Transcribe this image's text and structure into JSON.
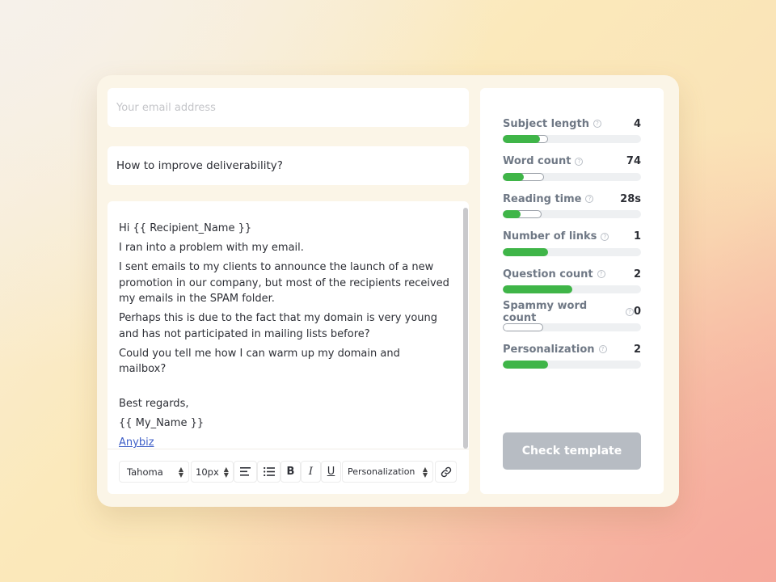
{
  "email": {
    "placeholder": "Your email address",
    "value": ""
  },
  "subject": "How to improve deliverability?",
  "body": {
    "greeting": "Hi {{ Recipient_Name }}",
    "line1": "I ran into a problem with my email.",
    "line2": "I sent emails to my clients to announce the launch of a new promotion in our company, but most of the recipients received my emails in the SPAM folder.",
    "line3": "Perhaps this is due to the fact that my domain is very young and has not participated in mailing lists before?",
    "line4": "Could you tell me how I can warm up my domain and mailbox?",
    "signoff": "Best regards,",
    "name": "{{ My_Name }}",
    "link": "Anybiz"
  },
  "toolbar": {
    "font": "Tahoma",
    "size": "10px",
    "bold": "B",
    "italic": "I",
    "underline": "U",
    "personalization": "Personalization"
  },
  "metrics": [
    {
      "label": "Subject length",
      "value": "4",
      "fill": 0.27,
      "outline": 0.33
    },
    {
      "label": "Word count",
      "value": "74",
      "fill": 0.15,
      "outline": 0.3
    },
    {
      "label": "Reading time",
      "value": "28s",
      "fill": 0.13,
      "outline": 0.28
    },
    {
      "label": "Number of links",
      "value": "1",
      "fill": 0.33,
      "outline": 0
    },
    {
      "label": "Question count",
      "value": "2",
      "fill": 0.5,
      "outline": 0
    },
    {
      "label": "Spammy word count",
      "value": "0",
      "fill": 0,
      "outline": 0.29
    },
    {
      "label": "Personalization",
      "value": "2",
      "fill": 0.33,
      "outline": 0
    }
  ],
  "check_button": "Check template",
  "colors": {
    "accent_green": "#3fb548",
    "button_disabled": "#b7bcc3",
    "link": "#3f5fc7"
  }
}
